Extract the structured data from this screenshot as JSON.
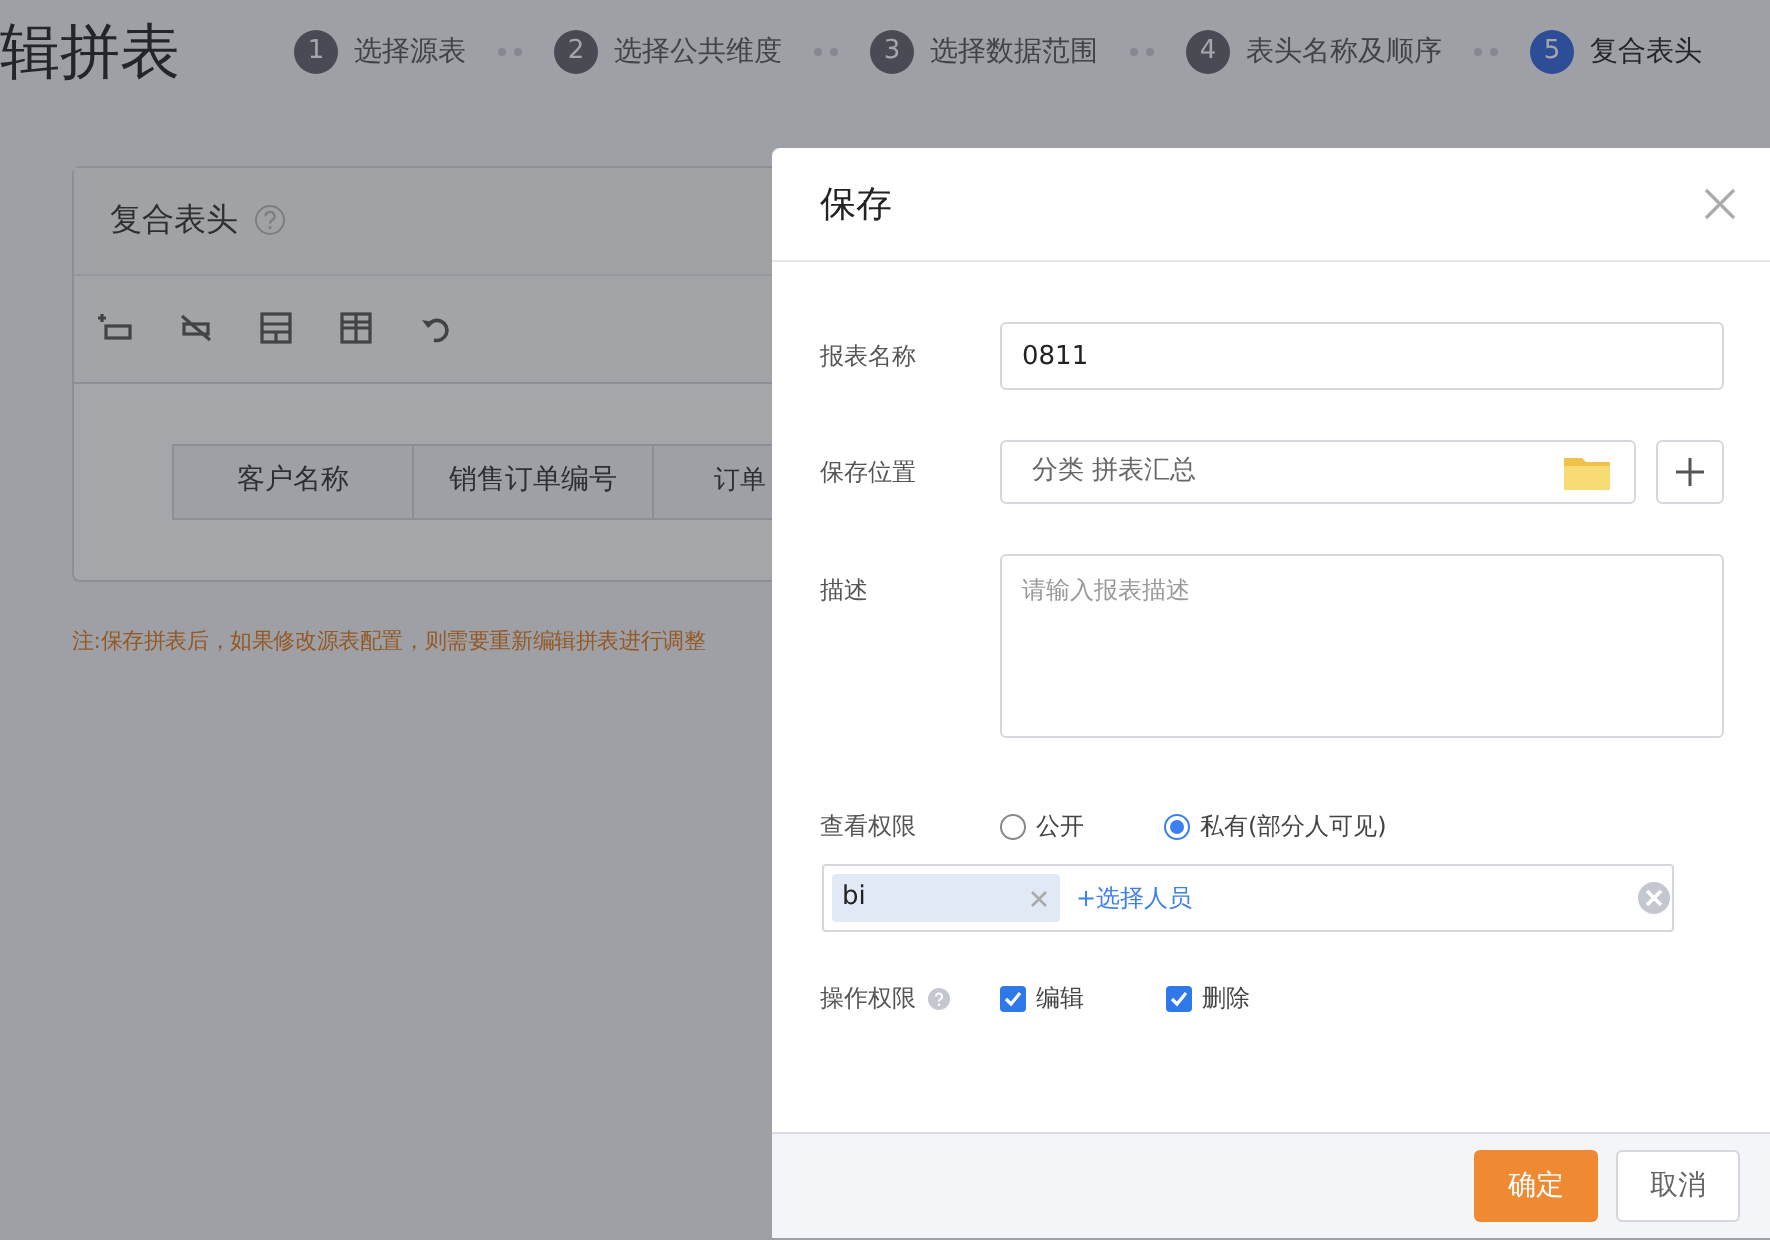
{
  "page": {
    "title": "辑拼表",
    "steps": [
      {
        "number": "1",
        "label": "选择源表",
        "selected": false
      },
      {
        "number": "2",
        "label": "选择公共维度",
        "selected": false
      },
      {
        "number": "3",
        "label": "选择数据范围",
        "selected": false
      },
      {
        "number": "4",
        "label": "表头名称及顺序",
        "selected": false
      },
      {
        "number": "5",
        "label": "复合表头",
        "selected": true
      }
    ],
    "panel": {
      "title": "复合表头",
      "header_cells": [
        "客户名称",
        "销售订单编号",
        "订单"
      ]
    },
    "note": "注:保存拼表后，如果修改源表配置，则需要重新编辑拼表进行调整"
  },
  "dialog": {
    "title": "保存",
    "name_label": "报表名称",
    "name_value": "0811",
    "location_label": "保存位置",
    "location_value": "分类 拼表汇总",
    "description_label": "描述",
    "description_placeholder": "请输入报表描述",
    "view_label": "查看权限",
    "view_options": [
      {
        "label": "公开",
        "selected": false
      },
      {
        "label": "私有(部分人可见)",
        "selected": true
      }
    ],
    "members": [
      {
        "name": "bi"
      }
    ],
    "add_member": "+选择人员",
    "operate_label": "操作权限",
    "operate_options": [
      {
        "label": "编辑",
        "checked": true
      },
      {
        "label": "删除",
        "checked": true
      }
    ],
    "buttons": [
      {
        "label": "确定",
        "kind": "primary"
      },
      {
        "label": "取消",
        "kind": "secondary"
      }
    ]
  }
}
